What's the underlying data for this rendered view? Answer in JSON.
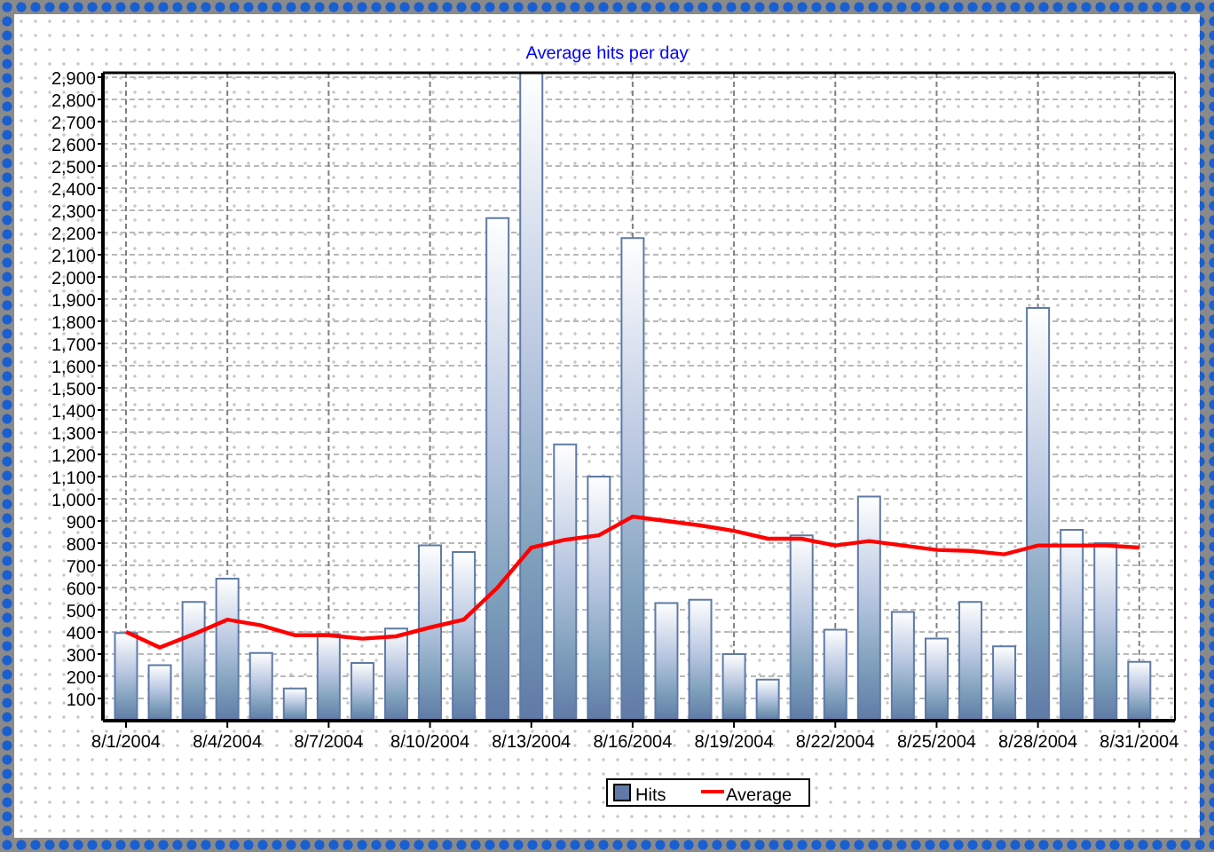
{
  "chart_data": {
    "type": "bar",
    "title": "Average hits per day",
    "categories": [
      "8/1/2004",
      null,
      null,
      "8/4/2004",
      null,
      null,
      "8/7/2004",
      null,
      null,
      "8/10/2004",
      null,
      null,
      "8/13/2004",
      null,
      null,
      "8/16/2004",
      null,
      null,
      "8/19/2004",
      null,
      null,
      "8/22/2004",
      null,
      null,
      "8/25/2004",
      null,
      null,
      "8/28/2004",
      null,
      null,
      "8/31/2004"
    ],
    "ylim": [
      0,
      2920
    ],
    "grid": true,
    "legend": true,
    "yticks": [
      100,
      200,
      300,
      400,
      500,
      600,
      700,
      800,
      900,
      {
        "value": 1000,
        "label": "1,000"
      },
      {
        "value": 1100,
        "label": "1,100"
      },
      {
        "value": 1200,
        "label": "1,200"
      },
      {
        "value": 1300,
        "label": "1,300"
      },
      {
        "value": 1400,
        "label": "1,400"
      },
      {
        "value": 1500,
        "label": "1,500"
      },
      {
        "value": 1600,
        "label": "1,600"
      },
      {
        "value": 1700,
        "label": "1,700"
      },
      {
        "value": 1800,
        "label": "1,800"
      },
      {
        "value": 1900,
        "label": "1,900"
      },
      {
        "value": 2000,
        "label": "2,000"
      },
      {
        "value": 2100,
        "label": "2,100"
      },
      {
        "value": 2200,
        "label": "2,200"
      },
      {
        "value": 2300,
        "label": "2,300"
      },
      {
        "value": 2400,
        "label": "2,400"
      },
      {
        "value": 2500,
        "label": "2,500"
      },
      {
        "value": 2600,
        "label": "2,600"
      },
      {
        "value": 2700,
        "label": "2,700"
      },
      {
        "value": 2800,
        "label": "2,800"
      },
      {
        "value": 2900,
        "label": "2,900"
      }
    ],
    "series": [
      {
        "name": "Hits",
        "color": "#5f7aa6",
        "values": [
          395,
          250,
          535,
          640,
          305,
          145,
          390,
          260,
          415,
          790,
          760,
          2265,
          2920,
          1245,
          1100,
          2175,
          530,
          545,
          300,
          185,
          835,
          410,
          1010,
          490,
          370,
          535,
          335,
          1860,
          860,
          800,
          265
        ]
      },
      {
        "name": "Average",
        "type": "line",
        "color": "#ff0000",
        "values": [
          400,
          330,
          390,
          455,
          430,
          385,
          385,
          370,
          380,
          420,
          455,
          600,
          780,
          815,
          835,
          920,
          900,
          880,
          855,
          820,
          820,
          790,
          810,
          790,
          770,
          765,
          750,
          790,
          790,
          790,
          780
        ]
      }
    ]
  }
}
